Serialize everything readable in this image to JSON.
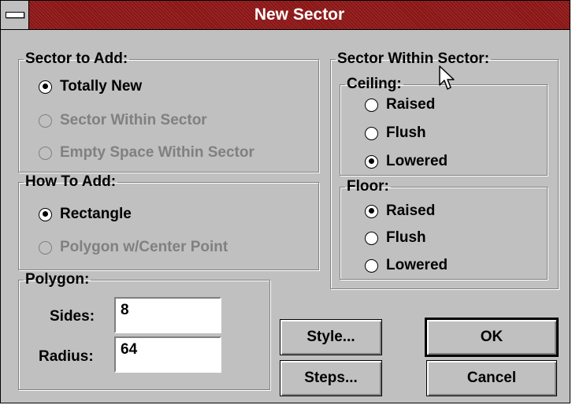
{
  "window": {
    "title": "New Sector"
  },
  "sector_to_add": {
    "label": "Sector to Add:",
    "options": [
      {
        "label": "Totally New",
        "checked": true,
        "enabled": true
      },
      {
        "label": "Sector Within Sector",
        "checked": false,
        "enabled": false
      },
      {
        "label": "Empty Space Within Sector",
        "checked": false,
        "enabled": false
      }
    ]
  },
  "how_to_add": {
    "label": "How To Add:",
    "options": [
      {
        "label": "Rectangle",
        "checked": true,
        "enabled": true
      },
      {
        "label": "Polygon w/Center Point",
        "checked": false,
        "enabled": false
      }
    ]
  },
  "polygon": {
    "label": "Polygon:",
    "sides_label": "Sides:",
    "sides_value": "8",
    "radius_label": "Radius:",
    "radius_value": "64"
  },
  "sector_within_sector": {
    "label": "Sector Within Sector:",
    "ceiling": {
      "label": "Ceiling:",
      "options": [
        {
          "label": "Raised",
          "checked": false
        },
        {
          "label": "Flush",
          "checked": false
        },
        {
          "label": "Lowered",
          "checked": true
        }
      ]
    },
    "floor": {
      "label": "Floor:",
      "options": [
        {
          "label": "Raised",
          "checked": true
        },
        {
          "label": "Flush",
          "checked": false
        },
        {
          "label": "Lowered",
          "checked": false
        }
      ]
    }
  },
  "buttons": {
    "style": "Style...",
    "steps": "Steps...",
    "ok": "OK",
    "cancel": "Cancel"
  },
  "icons": {
    "system_menu": "system-menu-icon",
    "cursor": "mouse-pointer-icon"
  }
}
